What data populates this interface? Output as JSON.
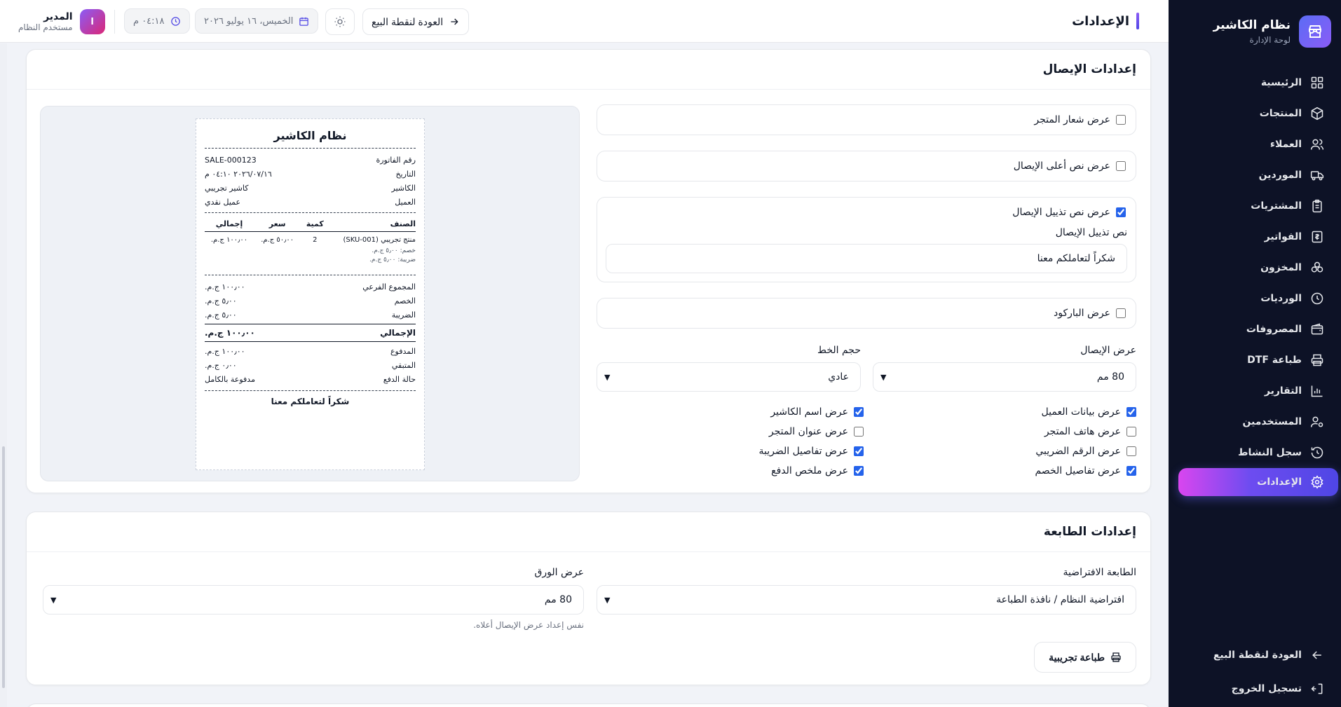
{
  "app": {
    "name": "نظام الكاشير",
    "subtitle": "لوحة الإدارة"
  },
  "sidebar": {
    "items": [
      {
        "label": "الرئيسية",
        "icon": "dashboard-icon"
      },
      {
        "label": "المنتجات",
        "icon": "box-icon"
      },
      {
        "label": "العملاء",
        "icon": "users-icon"
      },
      {
        "label": "الموردين",
        "icon": "truck-icon"
      },
      {
        "label": "المشتريات",
        "icon": "clipboard-icon"
      },
      {
        "label": "الفواتير",
        "icon": "invoice-icon"
      },
      {
        "label": "المخزون",
        "icon": "stack-icon"
      },
      {
        "label": "الورديات",
        "icon": "clock-icon"
      },
      {
        "label": "المصروفات",
        "icon": "wallet-icon"
      },
      {
        "label": "طباعة DTF",
        "icon": "printer-icon"
      },
      {
        "label": "التقارير",
        "icon": "chart-icon"
      },
      {
        "label": "المستخدمين",
        "icon": "user-cog-icon"
      },
      {
        "label": "سجل النشاط",
        "icon": "history-icon"
      },
      {
        "label": "الإعدادات",
        "icon": "gear-icon",
        "active": true
      }
    ],
    "bottom": [
      {
        "label": "العودة لنقطة البيع",
        "icon": "arrow-left-icon"
      },
      {
        "label": "تسجيل الخروج",
        "icon": "logout-icon"
      }
    ]
  },
  "header": {
    "title": "الإعدادات",
    "back_label": "العودة لنقطة البيع",
    "date": "الخميس، ١٦ يوليو ٢٠٢٦",
    "time": "٠٤:١٨ م",
    "user_initial": "ا",
    "user_name": "المدير",
    "user_role": "مستخدم النظام"
  },
  "receipt_settings": {
    "title": "إعدادات الإيصال",
    "show_logo": {
      "label": "عرض شعار المتجر",
      "checked": false
    },
    "show_header_text": {
      "label": "عرض نص أعلى الإيصال",
      "checked": false
    },
    "show_footer_text": {
      "label": "عرض نص تذييل الإيصال",
      "checked": true
    },
    "footer_text_label": "نص تذييل الإيصال",
    "footer_text_value": "شكراً لتعاملكم معنا",
    "show_barcode": {
      "label": "عرض الباركود",
      "checked": false
    },
    "receipt_width_label": "عرض الإيصال",
    "receipt_width_value": "80 مم",
    "font_size_label": "حجم الخط",
    "font_size_value": "عادي",
    "checks": [
      {
        "label": "عرض بيانات العميل",
        "checked": true
      },
      {
        "label": "عرض اسم الكاشير",
        "checked": true
      },
      {
        "label": "عرض هاتف المتجر",
        "checked": false
      },
      {
        "label": "عرض عنوان المتجر",
        "checked": false
      },
      {
        "label": "عرض الرقم الضريبي",
        "checked": false
      },
      {
        "label": "عرض تفاصيل الضريبة",
        "checked": true
      },
      {
        "label": "عرض تفاصيل الخصم",
        "checked": true
      },
      {
        "label": "عرض ملخص الدفع",
        "checked": true
      }
    ]
  },
  "receipt_preview": {
    "store_name": "نظام الكاشير",
    "invoice_label": "رقم الفاتورة",
    "invoice_value": "SALE-000123",
    "date_label": "التاريخ",
    "date_value": "٢٠٢٦/٠٧/١٦ ٠٤:١٠ م",
    "cashier_label": "الكاشير",
    "cashier_value": "كاشير تجريبي",
    "customer_label": "العميل",
    "customer_value": "عميل نقدي",
    "col_item": "الصنف",
    "col_qty": "كمية",
    "col_price": "سعر",
    "col_total": "إجمالي",
    "item_name": "منتج تجريبي (SKU-001)",
    "item_qty": "2",
    "item_price": "٥٠٫٠٠ ج.م.",
    "item_total": "١٠٠٫٠٠ ج.م.",
    "item_discount": "خصم: ٥٫٠٠ ج.م.",
    "item_tax": "ضريبة: ٥٫٠٠ ج.م.",
    "subtotal_label": "المجموع الفرعي",
    "subtotal_value": "١٠٠٫٠٠ ج.م.",
    "discount_label": "الخصم",
    "discount_value": "٥٫٠٠ ج.م.",
    "tax_label": "الضريبة",
    "tax_value": "٥٫٠٠ ج.م.",
    "total_label": "الإجمالي",
    "total_value": "١٠٠٫٠٠ ج.م.",
    "paid_label": "المدفوع",
    "paid_value": "١٠٠٫٠٠ ج.م.",
    "change_label": "المتبقي",
    "change_value": "٠٫٠٠ ج.م.",
    "status_label": "حالة الدفع",
    "status_value": "مدفوعة بالكامل",
    "footer": "شكراً لتعاملكم معنا"
  },
  "printer_settings": {
    "title": "إعدادات الطابعة",
    "default_printer_label": "الطابعة الافتراضية",
    "default_printer_value": "افتراضية النظام / نافذة الطباعة",
    "paper_width_label": "عرض الورق",
    "paper_width_value": "80 مم",
    "paper_hint": "نفس إعداد عرض الإيصال أعلاه.",
    "test_print_label": "طباعة تجريبية"
  },
  "colors": {
    "sidebar_bg": "#0d1226",
    "accent": "#4f46e5",
    "active_gradient_start": "#d946ef"
  }
}
